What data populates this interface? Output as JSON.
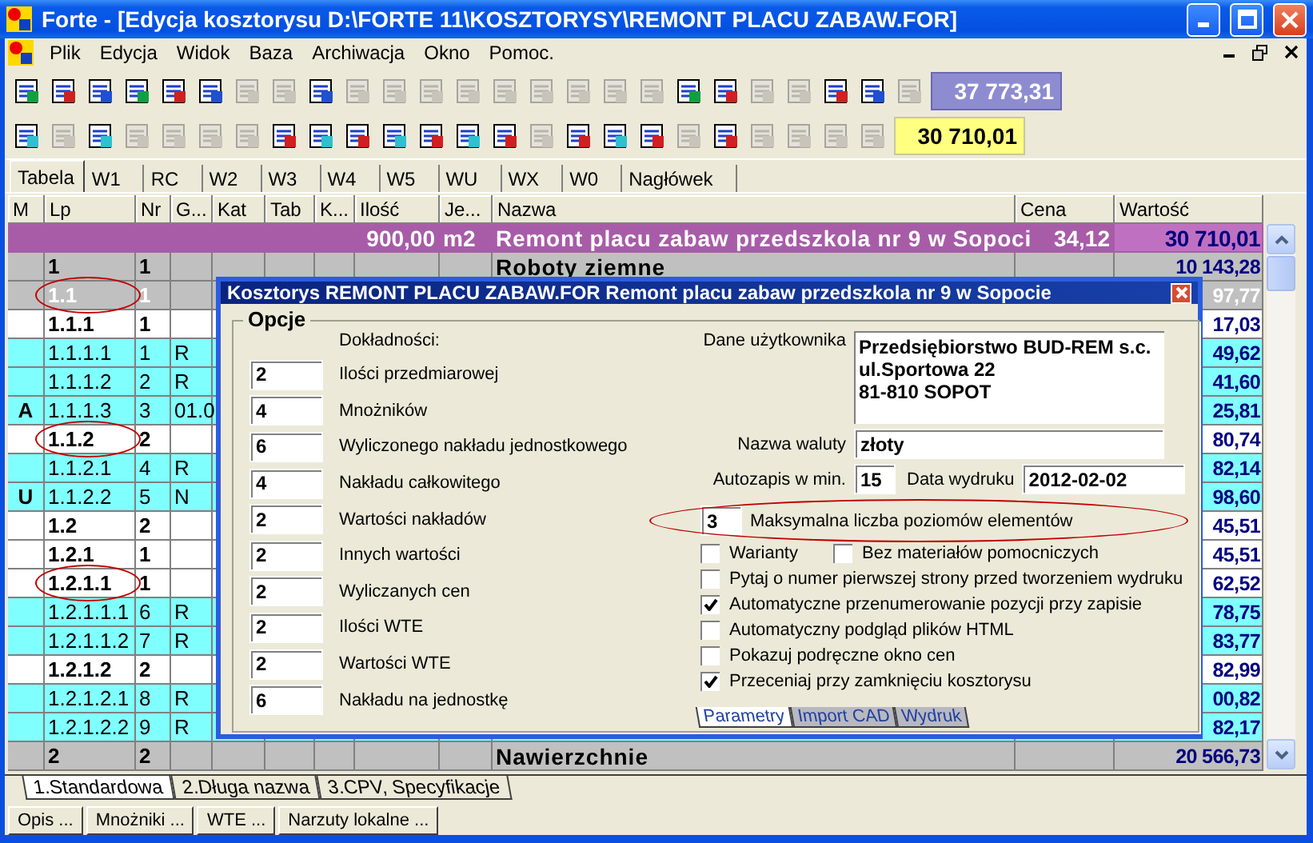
{
  "window": {
    "title": "Forte - [Edycja kosztorysu D:\\FORTE 11\\KOSZTORYSY\\REMONT PLACU ZABAW.FOR]"
  },
  "menu": [
    "Plik",
    "Edycja",
    "Widok",
    "Baza",
    "Archiwacja",
    "Okno",
    "Pomoc."
  ],
  "toolbar_1": {
    "buttons": [
      {
        "disabled": false
      },
      {
        "disabled": false
      },
      {
        "disabled": false
      },
      {
        "disabled": false
      },
      {
        "disabled": false
      },
      {
        "disabled": false
      },
      {
        "disabled": true
      },
      {
        "disabled": true
      },
      {
        "disabled": false
      },
      {
        "disabled": true
      },
      {
        "disabled": true
      },
      {
        "disabled": true
      },
      {
        "disabled": true
      },
      {
        "disabled": true
      },
      {
        "disabled": true
      },
      {
        "disabled": true
      },
      {
        "disabled": true
      },
      {
        "disabled": true
      },
      {
        "disabled": false
      },
      {
        "disabled": false
      },
      {
        "disabled": true
      },
      {
        "disabled": true
      },
      {
        "disabled": false
      },
      {
        "disabled": false
      },
      {
        "disabled": true
      }
    ],
    "total": "37 773,31"
  },
  "toolbar_2": {
    "buttons": [
      {
        "disabled": false
      },
      {
        "disabled": true
      },
      {
        "disabled": false
      },
      {
        "disabled": true
      },
      {
        "disabled": true
      },
      {
        "disabled": true
      },
      {
        "disabled": true
      },
      {
        "disabled": false
      },
      {
        "disabled": false
      },
      {
        "disabled": false
      },
      {
        "disabled": false
      },
      {
        "disabled": false
      },
      {
        "disabled": false
      },
      {
        "disabled": false
      },
      {
        "disabled": true
      },
      {
        "disabled": false
      },
      {
        "disabled": false
      },
      {
        "disabled": false
      },
      {
        "disabled": true
      },
      {
        "disabled": false
      },
      {
        "disabled": true
      },
      {
        "disabled": true
      },
      {
        "disabled": true
      },
      {
        "disabled": true
      }
    ],
    "total": "30 710,01"
  },
  "tabs": [
    {
      "label": "Tabela",
      "selected": true
    },
    {
      "label": "W1",
      "selected": false
    },
    {
      "label": "RC",
      "selected": false
    },
    {
      "label": "W2",
      "selected": false
    },
    {
      "label": "W3",
      "selected": false
    },
    {
      "label": "W4",
      "selected": false
    },
    {
      "label": "W5",
      "selected": false
    },
    {
      "label": "WU",
      "selected": false
    },
    {
      "label": "WX",
      "selected": false
    },
    {
      "label": "W0",
      "selected": false
    },
    {
      "label": "Nagłówek",
      "selected": false
    }
  ],
  "table": {
    "columns": [
      "M",
      "Lp",
      "Nr",
      "G...",
      "Kat",
      "Tab",
      "K...",
      "Ilość",
      "Je...",
      "Nazwa",
      "Cena",
      "Wartość"
    ],
    "rows": [
      {
        "kind": "total",
        "selected": false,
        "circled": false,
        "ilosc": "900,00",
        "je": "m2",
        "nazwa": "Remont placu zabaw przedszkola nr 9 w Sopoci",
        "cena": "34,12",
        "wartosc": "30 710,01"
      },
      {
        "kind": "section",
        "selected": false,
        "circled": false,
        "lp": "1",
        "nr": "1",
        "nazwa": "Roboty ziemne",
        "wartosc": "10 143,28"
      },
      {
        "kind": "section",
        "selected": true,
        "circled": true,
        "lp": "1.1",
        "nr": "1",
        "wartosc": "97,77"
      },
      {
        "kind": "element",
        "selected": false,
        "circled": false,
        "lp": "1.1.1",
        "nr": "1",
        "wartosc": "17,03"
      },
      {
        "kind": "item",
        "selected": false,
        "circled": false,
        "lp": "1.1.1.1",
        "nr": "1",
        "g": "R",
        "wartosc": "49,62"
      },
      {
        "kind": "item",
        "selected": false,
        "circled": false,
        "lp": "1.1.1.2",
        "nr": "2",
        "g": "R",
        "wartosc": "41,60"
      },
      {
        "kind": "item",
        "selected": false,
        "circled": false,
        "m": "A",
        "lp": "1.1.1.3",
        "nr": "3",
        "g": "01.0",
        "wartosc": "25,81"
      },
      {
        "kind": "element",
        "selected": false,
        "circled": true,
        "lp": "1.1.2",
        "nr": "2",
        "wartosc": "80,74"
      },
      {
        "kind": "item",
        "selected": false,
        "circled": false,
        "lp": "1.1.2.1",
        "nr": "4",
        "g": "R",
        "wartosc": "82,14"
      },
      {
        "kind": "item",
        "selected": false,
        "circled": false,
        "m": "U",
        "lp": "1.1.2.2",
        "nr": "5",
        "g": "N",
        "wartosc": "98,60"
      },
      {
        "kind": "element",
        "selected": false,
        "circled": false,
        "lp": "1.2",
        "nr": "2",
        "wartosc": "45,51"
      },
      {
        "kind": "element",
        "selected": false,
        "circled": false,
        "lp": "1.2.1",
        "nr": "1",
        "wartosc": "45,51"
      },
      {
        "kind": "element",
        "selected": false,
        "circled": true,
        "lp": "1.2.1.1",
        "nr": "1",
        "wartosc": "62,52"
      },
      {
        "kind": "item",
        "selected": false,
        "circled": false,
        "lp": "1.2.1.1.1",
        "nr": "6",
        "g": "R",
        "wartosc": "78,75"
      },
      {
        "kind": "item",
        "selected": false,
        "circled": false,
        "lp": "1.2.1.1.2",
        "nr": "7",
        "g": "R",
        "wartosc": "83,77"
      },
      {
        "kind": "element",
        "selected": false,
        "circled": false,
        "lp": "1.2.1.2",
        "nr": "2",
        "wartosc": "82,99"
      },
      {
        "kind": "item",
        "selected": false,
        "circled": false,
        "lp": "1.2.1.2.1",
        "nr": "8",
        "g": "R",
        "wartosc": "00,82"
      },
      {
        "kind": "item",
        "selected": false,
        "circled": false,
        "lp": "1.2.1.2.2",
        "nr": "9",
        "g": "R",
        "wartosc": "82,17"
      },
      {
        "kind": "section",
        "selected": false,
        "circled": false,
        "lp": "2",
        "nr": "2",
        "nazwa": "Nawierzchnie",
        "wartosc": "20 566,73"
      }
    ]
  },
  "view_tabs": [
    {
      "label": "1.Standardowa",
      "selected": true
    },
    {
      "label": "2.Długa nazwa",
      "selected": false
    },
    {
      "label": "3.CPV, Specyfikacje",
      "selected": false
    }
  ],
  "buttons": [
    "Opis ...",
    "Mnożniki ...",
    "WTE ...",
    "Narzuty lokalne ..."
  ],
  "dialog": {
    "title": "Kosztorys REMONT PLACU ZABAW.FOR Remont placu zabaw przedszkola nr 9 w Sopocie",
    "group": "Opcje",
    "precision_heading": "Dokładności:",
    "precision": [
      {
        "value": "2",
        "label": "Ilości przedmiarowej"
      },
      {
        "value": "4",
        "label": "Mnożników"
      },
      {
        "value": "6",
        "label": "Wyliczonego nakładu jednostkowego"
      },
      {
        "value": "4",
        "label": "Nakładu całkowitego"
      },
      {
        "value": "2",
        "label": "Wartości nakładów"
      },
      {
        "value": "2",
        "label": "Innych wartości"
      },
      {
        "value": "2",
        "label": "Wyliczanych cen"
      },
      {
        "value": "2",
        "label": "Ilości WTE"
      },
      {
        "value": "2",
        "label": "Wartości WTE"
      },
      {
        "value": "6",
        "label": "Nakładu na jednostkę"
      }
    ],
    "user_data": {
      "label": "Dane użytkownika",
      "lines": [
        "Przedsiębiorstwo BUD-REM s.c.",
        "ul.Sportowa 22",
        "81-810 SOPOT"
      ]
    },
    "currency": {
      "label": "Nazwa waluty",
      "value": "złoty"
    },
    "autosave": {
      "label": "Autozapis w min.",
      "value": "15"
    },
    "print_date": {
      "label": "Data wydruku",
      "value": "2012-02-02"
    },
    "max_levels": {
      "value": "3",
      "label": "Maksymalna liczba poziomów elementów",
      "circled": true
    },
    "checkbox_rows": [
      [
        {
          "label": "Warianty",
          "checked": false
        },
        {
          "label": "Bez materiałów pomocniczych",
          "checked": false
        }
      ],
      [
        {
          "label": "Pytaj o numer pierwszej strony przed tworzeniem wydruku",
          "checked": false
        }
      ],
      [
        {
          "label": "Automatyczne przenumerowanie pozycji przy zapisie",
          "checked": true
        }
      ],
      [
        {
          "label": "Automatyczny podgląd plików HTML",
          "checked": false
        }
      ],
      [
        {
          "label": "Pokazuj podręczne okno cen",
          "checked": false
        }
      ],
      [
        {
          "label": "Przeceniaj przy zamknięciu kosztorysu",
          "checked": true
        }
      ]
    ],
    "tabs": [
      {
        "label": "Parametry",
        "selected": true
      },
      {
        "label": "Import CAD",
        "selected": false
      },
      {
        "label": "Wydruk",
        "selected": false
      }
    ]
  }
}
